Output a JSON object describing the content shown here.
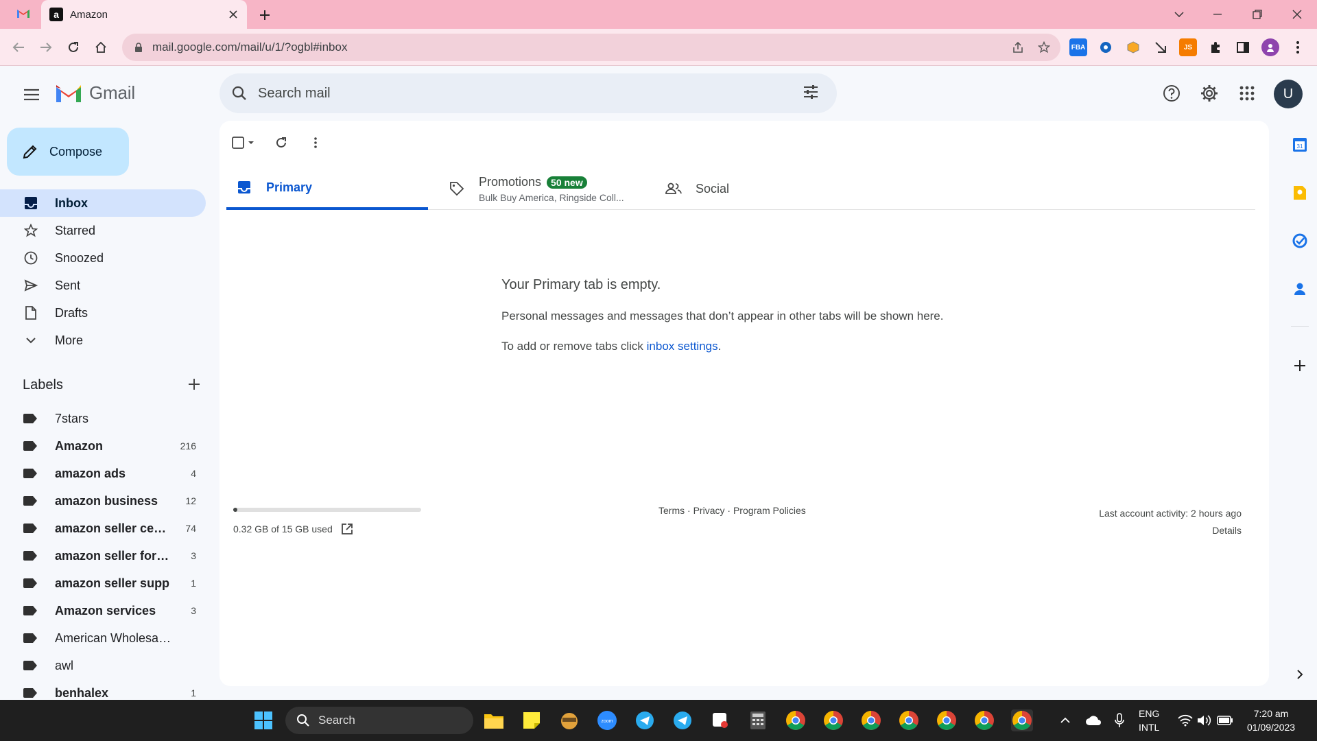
{
  "browser": {
    "tabs": [
      {
        "title": "",
        "icon": "gmail-favicon"
      },
      {
        "title": "Amazon",
        "icon": "amazon-favicon"
      }
    ],
    "url": "mail.google.com/mail/u/1/?ogbl#inbox",
    "extensions": [
      "fba-extension-icon",
      "puzzle-helper-icon",
      "cube-extension-icon",
      "send-extension-icon",
      "js-extension-icon",
      "extensions-puzzle-icon",
      "side-panel-icon",
      "profile-icon"
    ],
    "ext_js_label": "JS",
    "ext_fba_label": "FBA"
  },
  "gmail": {
    "app_name": "Gmail",
    "search_placeholder": "Search mail",
    "avatar_letter": "U",
    "compose_label": "Compose",
    "nav": [
      {
        "label": "Inbox",
        "icon": "inbox-icon",
        "active": true
      },
      {
        "label": "Starred",
        "icon": "star-icon"
      },
      {
        "label": "Snoozed",
        "icon": "clock-icon"
      },
      {
        "label": "Sent",
        "icon": "send-icon"
      },
      {
        "label": "Drafts",
        "icon": "draft-icon"
      },
      {
        "label": "More",
        "icon": "chevron-down-icon"
      }
    ],
    "labels_heading": "Labels",
    "labels": [
      {
        "name": "7stars",
        "count": "",
        "bold": false
      },
      {
        "name": "Amazon",
        "count": "216",
        "bold": true
      },
      {
        "name": "amazon ads",
        "count": "4",
        "bold": true
      },
      {
        "name": "amazon business",
        "count": "12",
        "bold": true
      },
      {
        "name": "amazon seller cen...",
        "count": "74",
        "bold": true
      },
      {
        "name": "amazon seller foru...",
        "count": "3",
        "bold": true
      },
      {
        "name": "amazon seller supp",
        "count": "1",
        "bold": true
      },
      {
        "name": "Amazon services",
        "count": "3",
        "bold": true
      },
      {
        "name": "American Wholesaler",
        "count": "",
        "bold": false
      },
      {
        "name": "awl",
        "count": "",
        "bold": false
      },
      {
        "name": "benhalex",
        "count": "1",
        "bold": true
      }
    ],
    "tabs": {
      "primary": "Primary",
      "promotions": "Promotions",
      "promotions_badge": "50 new",
      "promotions_sub": "Bulk Buy America, Ringside Coll...",
      "social": "Social"
    },
    "empty": {
      "title": "Your Primary tab is empty.",
      "line1": "Personal messages and messages that don’t appear in other tabs will be shown here.",
      "line2_prefix": "To add or remove tabs click ",
      "line2_link": "inbox settings",
      "line2_suffix": "."
    },
    "storage": {
      "text": "0.32 GB of 15 GB used",
      "fraction": 0.021
    },
    "footer": {
      "terms": "Terms",
      "privacy": "Privacy",
      "policies": "Program Policies",
      "sep": " · ",
      "activity": "Last account activity: 2 hours ago",
      "details": "Details"
    }
  },
  "taskbar": {
    "search_label": "Search",
    "lang_top": "ENG",
    "lang_bottom": "INTL",
    "time": "7:20 am",
    "date": "01/09/2023",
    "zoom_label": "zoom"
  },
  "colors": {
    "tab_strip": "#f7b5c6",
    "toolbar": "#fce8ee",
    "compose": "#c2e7ff",
    "inbox_active": "#d3e3fd",
    "primary_blue": "#0b57d0",
    "promotions_badge": "#188038"
  }
}
